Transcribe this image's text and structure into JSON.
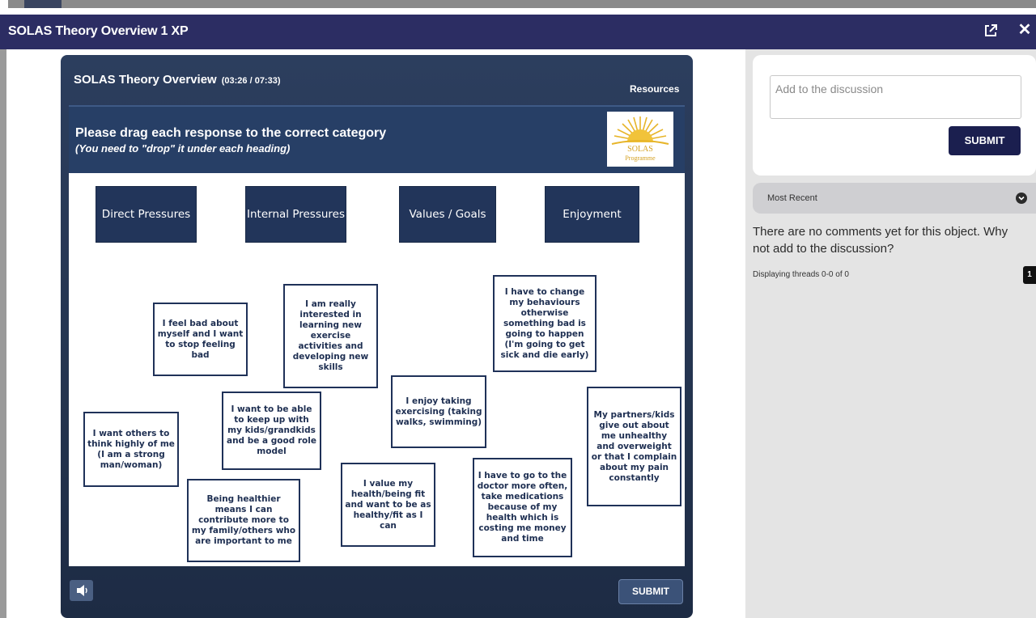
{
  "window": {
    "title": "SOLAS Theory Overview   1 XP"
  },
  "player": {
    "title": "SOLAS Theory Overview",
    "time": "(03:26 / 07:33)",
    "resources_label": "Resources",
    "instruction": "Please drag each response to the correct category",
    "instruction_sub": "(You need to \"drop\" it under each heading)",
    "logo_text_1": "SOLAS",
    "logo_text_2": "Programme",
    "categories": [
      "Direct Pressures",
      "Internal Pressures",
      "Values / Goals",
      "Enjoyment"
    ],
    "cards": [
      "I feel bad about myself and I want to stop feeling bad",
      "I am really interested in learning new exercise activities and developing new skills",
      "I have to change my behaviours otherwise something bad is going to happen (I'm going to get sick and die early)",
      "I enjoy taking exercising (taking walks, swimming)",
      "I want to be able to keep up with my kids/grandkids and be a good role model",
      "I want others to think highly of me (I am a strong man/woman)",
      "My partners/kids give out about me unhealthy and overweight or that I complain about my pain constantly",
      "I have to go to the doctor more often, take medications because of my health which is costing me money and time",
      "I value my health/being fit and want to be as healthy/fit as I can",
      "Being healthier means I can contribute more to my family/others who are important to me"
    ],
    "submit_label": "SUBMIT"
  },
  "discussion": {
    "placeholder": "Add to the discussion",
    "submit_label": "SUBMIT",
    "sort_label": "Most Recent",
    "empty_message": "There are no comments yet for this object. Why not add to the discussion?",
    "threads_info": "Displaying threads 0-0 of 0",
    "page": "1"
  },
  "colors": {
    "header": "#2c2d63",
    "player": "#24344f",
    "card_border": "#1f3158",
    "category": "#22355a",
    "submit_dark": "#1b1f4f"
  }
}
